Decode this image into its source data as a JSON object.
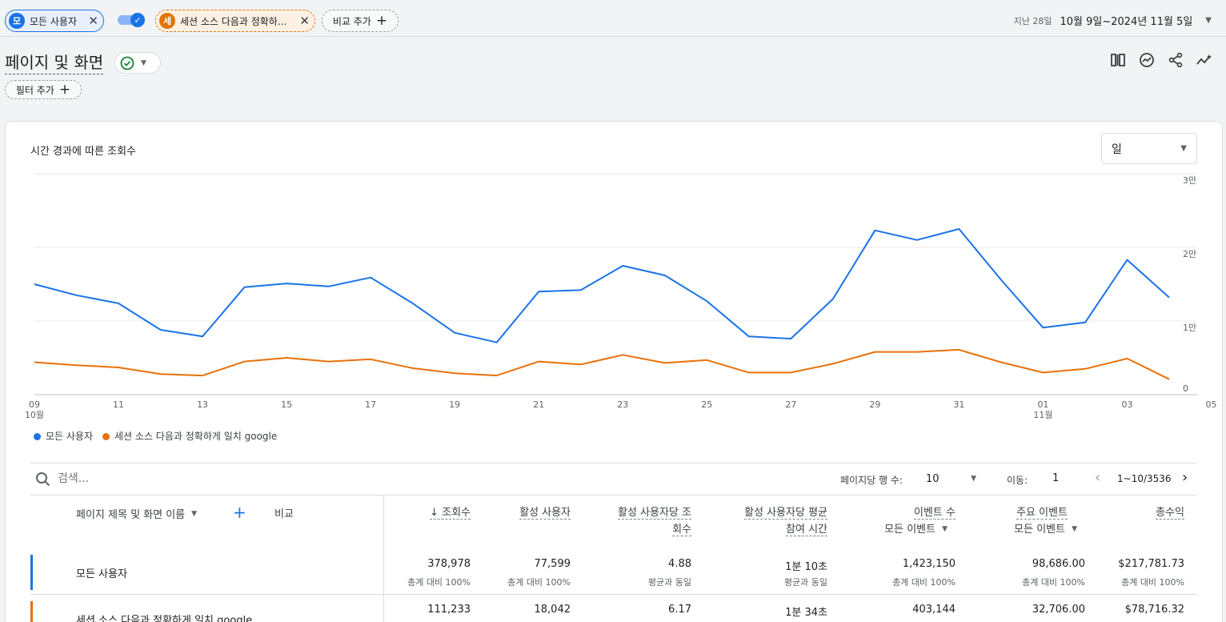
{
  "topbar": {
    "segments": [
      {
        "badge": "모",
        "label": "모든 사용자",
        "color": "#1a73e8"
      },
      {
        "badge": "세",
        "label": "세션 소스 다음과 정확하...",
        "color": "#e37400"
      }
    ],
    "add_comparison": "비교 추가",
    "date_prefix": "지난 28일",
    "date_range": "10월 9일~2024년 11월 5일"
  },
  "page": {
    "title": "페이지 및 화면",
    "add_filter": "필터 추가"
  },
  "chart": {
    "title": "시간 경과에 따른 조회수",
    "granularity": "일",
    "legend": [
      "모든 사용자",
      "세션 소스 다음과 정확하게 일치 google"
    ]
  },
  "chart_data": {
    "type": "line",
    "x": [
      "10월 9일",
      "10월 10일",
      "10월 11일",
      "10월 12일",
      "10월 13일",
      "10월 14일",
      "10월 15일",
      "10월 16일",
      "10월 17일",
      "10월 18일",
      "10월 19일",
      "10월 20일",
      "10월 21일",
      "10월 22일",
      "10월 23일",
      "10월 24일",
      "10월 25일",
      "10월 26일",
      "10월 27일",
      "10월 28일",
      "10월 29일",
      "10월 30일",
      "10월 31일",
      "11월 1일",
      "11월 2일",
      "11월 3일",
      "11월 4일",
      "11월 5일"
    ],
    "x_tick_labels": [
      "09",
      "11",
      "13",
      "15",
      "17",
      "19",
      "21",
      "23",
      "25",
      "27",
      "29",
      "31",
      "01",
      "03",
      "05"
    ],
    "x_tick_month_labels": [
      {
        "at": "09",
        "label": "10월"
      },
      {
        "at": "01",
        "label": "11월"
      }
    ],
    "y_tick_labels": [
      "0",
      "1만",
      "2만",
      "3만"
    ],
    "ylim": [
      0,
      30000
    ],
    "series": [
      {
        "name": "모든 사용자",
        "color": "#1a73e8",
        "values": [
          15000,
          13500,
          12400,
          8800,
          7900,
          14600,
          15100,
          14700,
          15900,
          12400,
          8400,
          7100,
          14000,
          14200,
          17500,
          16200,
          12700,
          7900,
          7600,
          13000,
          22300,
          21000,
          22500,
          15600,
          9100,
          9800,
          18300,
          13200
        ]
      },
      {
        "name": "세션 소스 다음과 정확하게 일치 google",
        "color": "#e8710a",
        "values": [
          4400,
          4000,
          3700,
          2800,
          2600,
          4500,
          5000,
          4500,
          4800,
          3600,
          2900,
          2600,
          4500,
          4100,
          5400,
          4300,
          4700,
          3000,
          3000,
          4200,
          5800,
          5800,
          6100,
          4400,
          3000,
          3500,
          4900,
          2100
        ]
      }
    ],
    "grid": true
  },
  "table": {
    "search_placeholder": "검색...",
    "rows_per_page_label": "페이지당 행 수:",
    "rows_per_page": "10",
    "goto_label": "이동:",
    "goto_value": "1",
    "page_range": "1~10/3536",
    "dim_header": "페이지 제목 및 화면 이름",
    "compare_label": "비교",
    "columns": [
      {
        "l1": "↓ 조회수",
        "l2": ""
      },
      {
        "l1": "활성 사용자",
        "l2": ""
      },
      {
        "l1": "활성 사용자당 조",
        "l2": "회수"
      },
      {
        "l1": "활성 사용자당 평균",
        "l2": "참여 시간"
      },
      {
        "l1": "이벤트 수",
        "l2": "모든 이벤트"
      },
      {
        "l1": "주요 이벤트",
        "l2": "모든 이벤트"
      },
      {
        "l1": "총수익",
        "l2": ""
      }
    ],
    "rows": [
      {
        "label": "모든 사용자",
        "color": "#1a73e8",
        "values": [
          "378,978",
          "77,599",
          "4.88",
          "1분 10초",
          "1,423,150",
          "98,686.00",
          "$217,781.73"
        ],
        "subs": [
          "총계 대비 100%",
          "총계 대비 100%",
          "평균과 동일",
          "평균과 동일",
          "총계 대비 100%",
          "총계 대비 100%",
          "총계 대비 100%"
        ]
      },
      {
        "label": "세션 소스 다음과 정확하게 일치 google",
        "color": "#e8710a",
        "values": [
          "111,233",
          "18,042",
          "6.17",
          "1분 34초",
          "403,144",
          "32,706.00",
          "$78,716.32"
        ],
        "subs": [
          "",
          "",
          "",
          "",
          "",
          "",
          ""
        ]
      }
    ]
  }
}
